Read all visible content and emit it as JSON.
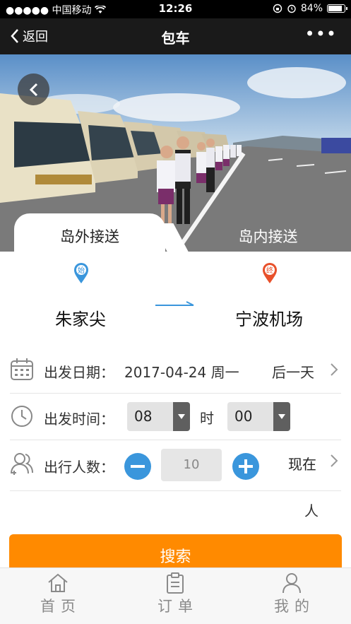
{
  "status_bar": {
    "carrier": "●●●●● 中国移动",
    "time": "12:26",
    "battery": "84%"
  },
  "nav": {
    "back_label": "返回",
    "title": "包车"
  },
  "tabs": [
    {
      "label": "岛外接送",
      "active": true
    },
    {
      "label": "岛内接送",
      "active": false
    }
  ],
  "route": {
    "start_pin": "始",
    "end_pin": "终",
    "from": "朱家尖",
    "to": "宁波机场"
  },
  "form": {
    "date_label": "出发日期：",
    "date_value": "2017-04-24 周一",
    "date_next": "后一天",
    "time_label": "出发时间：",
    "hour": "08",
    "hour_unit": "时",
    "minute": "00",
    "people_label": "出行人数：",
    "people_count": "10",
    "people_right": "现在",
    "people_unit": "人"
  },
  "search_button": "搜索",
  "tabbar": [
    {
      "label": "首页",
      "icon": "home-icon"
    },
    {
      "label": "订单",
      "icon": "order-icon"
    },
    {
      "label": "我的",
      "icon": "user-icon"
    }
  ],
  "colors": {
    "accent_blue": "#3a96dc",
    "search_orange": "#ff8a00",
    "end_pin_red": "#e8502a"
  }
}
